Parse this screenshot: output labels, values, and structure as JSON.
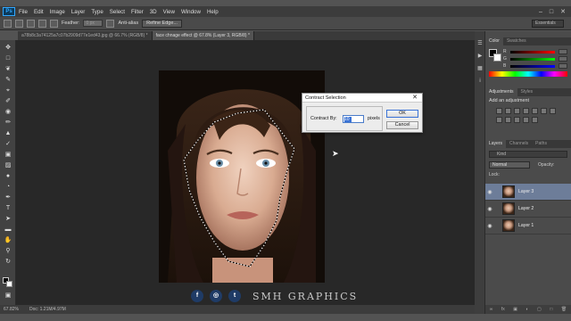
{
  "menubar": {
    "logo": "Ps",
    "items": [
      "File",
      "Edit",
      "Image",
      "Layer",
      "Type",
      "Select",
      "Filter",
      "3D",
      "View",
      "Window",
      "Help"
    ]
  },
  "options": {
    "feather_label": "Feather:",
    "feather_value": "0 px",
    "antialias_label": "Anti-alias",
    "refine_label": "Refine Edge..."
  },
  "workspace": "Essentials",
  "tabs": [
    {
      "label": "a78b8c3a74125a7c07b2909d77e1ed43.jpg @ 66.7% (RGB/8) *",
      "active": false
    },
    {
      "label": "face chnage effect @ 67.8% (Layer 3, RGB/8) *",
      "active": true
    }
  ],
  "status": {
    "zoom": "67.82%",
    "doc": "Doc: 1.21M/4.97M"
  },
  "dialog": {
    "title": "Contract Selection",
    "label": "Contract By:",
    "value": "10",
    "unit": "pixels",
    "ok": "OK",
    "cancel": "Cancel"
  },
  "panels": {
    "color_tabs": [
      "Color",
      "Swatches"
    ],
    "adj_tabs": [
      "Adjustments",
      "Styles"
    ],
    "adj_title": "Add an adjustment",
    "layer_tabs": [
      "Layers",
      "Channels",
      "Paths"
    ],
    "kind": "Kind",
    "blend_mode": "Normal",
    "opacity_label": "Opacity:",
    "fill_label": "Fill:",
    "lock_label": "Lock:"
  },
  "layers": [
    {
      "name": "Layer 3",
      "selected": true
    },
    {
      "name": "Layer 2",
      "selected": false
    },
    {
      "name": "Layer 1",
      "selected": false
    }
  ],
  "watermark": {
    "brand": "SMH GRAPHICS"
  },
  "icons": {
    "facebook": "f",
    "instagram": "◎",
    "twitter": "t"
  }
}
